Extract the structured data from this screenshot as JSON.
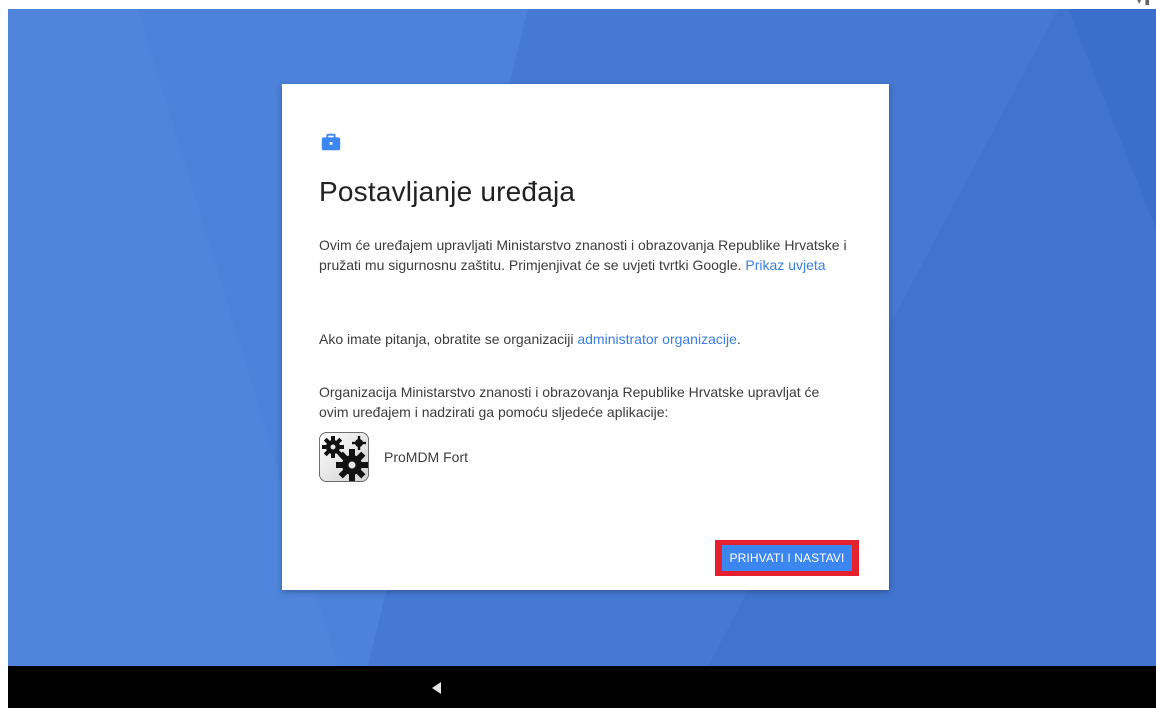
{
  "colors": {
    "wallpaper": "#4a80d8",
    "accent": "#3c86f0",
    "link": "#3b7fe0",
    "highlight": "#e5202f",
    "nav_bar": "#000000"
  },
  "status_bar": {
    "icons": [
      "wifi-icon",
      "battery-icon"
    ]
  },
  "card": {
    "header_icon": "briefcase-icon",
    "title": "Postavljanje uređaja",
    "paragraph1": {
      "text": "Ovim će uređajem upravljati Ministarstvo znanosti i obrazovanja Republike Hrvatske i pružati mu sigurnosnu zaštitu. Primjenjivat će se uvjeti tvrtki Google. ",
      "link": "Prikaz uvjeta"
    },
    "paragraph2": {
      "text": "Ako imate pitanja, obratite se organizaciji ",
      "link": "administrator organizacije",
      "suffix": "."
    },
    "paragraph3": {
      "text": "Organizacija Ministarstvo znanosti i obrazovanja Republike Hrvatske upravljat će ovim uređajem i nadzirati ga pomoću sljedeće aplikacije:"
    },
    "app": {
      "icon": "promdm-gears-icon",
      "name": "ProMDM Fort"
    },
    "accept_button": "PRIHVATI I NASTAVI"
  },
  "nav_bar": {
    "back_icon": "back-triangle-icon"
  }
}
